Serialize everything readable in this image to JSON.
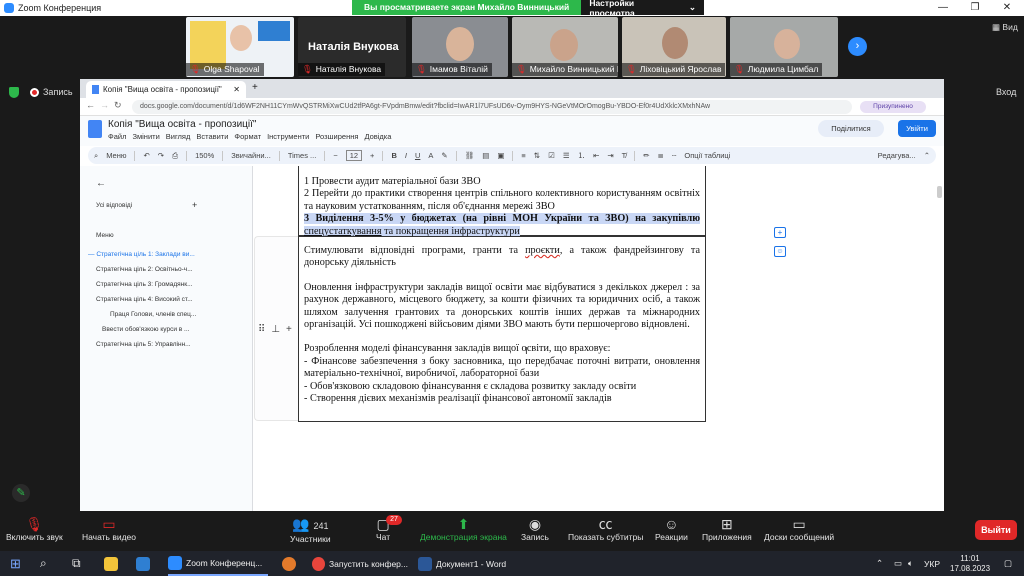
{
  "zoom": {
    "window_title": "Zoom Конференция",
    "share_message": "Вы просматриваете экран Михайло Винницький МОН",
    "view_options": "Настройки просмотра",
    "view_label": "Вид",
    "record_label": "Запись",
    "exit_label": "Вход",
    "participants": [
      {
        "name": "Olga Shapoval",
        "bg": "#dfe6ee"
      },
      {
        "name": "Наталія Внукова",
        "bg": "#2b2b2b"
      },
      {
        "name": "Імамов Віталій",
        "bg": "#8a8d92"
      },
      {
        "name": "Михайло Винницький М...",
        "bg": "#b9b9b5"
      },
      {
        "name": "Ліховіцький Ярослав",
        "bg": "#c9c3b8"
      },
      {
        "name": "Людмила Цимбал",
        "bg": "#a6a9a8"
      }
    ],
    "bottom": {
      "mic": "Включить звук",
      "video": "Начать видео",
      "participants": "Участники",
      "participants_count": "241",
      "chat": "Чат",
      "chat_badge": "27",
      "share": "Демонстрация экрана",
      "record": "Запись",
      "subtitles": "Показать субтитры",
      "reactions": "Реакции",
      "apps": "Приложения",
      "whiteboard": "Доски сообщений",
      "leave": "Выйти"
    }
  },
  "browser": {
    "tab_title": "Копія \"Вища освіта - пропозиції\"",
    "url": "docs.google.com/document/d/1d6WF2NH11CYmWvQSTRMiXwCUd2tfPA6gt-FVpdmBmw/edit?fbclid=IwAR1l7UFsUD6v-Oym9HYS-NGeVtMOrOmogBu-YBDO-Ef0r4UdXklcXMxhNAw",
    "profile_label": "Призупинено"
  },
  "docs": {
    "title": "Копія \"Вища освіта - пропозиції\"",
    "menu": [
      "Файл",
      "Змінити",
      "Вигляд",
      "Вставити",
      "Формат",
      "Інструменти",
      "Розширення",
      "Довідка"
    ],
    "share_button": "Поділитися",
    "login_button": "Увійти",
    "toolbar": {
      "menus": "Меню",
      "zoom": "150%",
      "style": "Звичайни...",
      "font": "Times ...",
      "size": "12",
      "table_options": "Опції таблиці",
      "edit_mode": "Редагува..."
    },
    "outline": {
      "hidden_label": "Усі відповіді",
      "menu_header": "Меню",
      "items": [
        "Стратегічна ціль 1: Заклади ви...",
        "Стратегічна ціль 2: Освітньо-ч...",
        "Стратегічна ціль 3: Громадянк...",
        "Стратегічна ціль 4: Високий ст...",
        "Праця Голови, членів спец...",
        "Ввести обов'язкою курси в ...",
        "Стратегічна ціль 5: Управлінн..."
      ]
    },
    "cell1": {
      "line1": "1 Провести аудит матеріальної бази ЗВО",
      "line2": "2 Перейти до практики створення центрів спільного колективного користуванням освітніх та науковим устаткованням, після об'єднання мережі ЗВО",
      "line3a": "3 ",
      "line3b": "Виділення 3-5% у бюджетах (на рівні МОН України та ЗВО) на закупівлю ",
      "line3c": "спецустаткування",
      "line3d": " та покращення інфраструктури"
    },
    "cell2": {
      "p1a": "Стимулювати відповідні програми, гранти та ",
      "p1b": "проєкти",
      "p1c": ", а також фандрейзингову та донорську діяльність",
      "p2": "Оновлення інфраструктури закладів вищої освіти має відбуватися з декількох джерел : за рахунок державного, місцевого бюджету, за кошти фізичних та юридичних осіб, а також шляхом залучення грантових та донорських коштів інших держав та міжнародних організацій. Усі пошкоджені війсьовим діями ЗВО мають бути першочергово відновлені.",
      "p3": "Розроблення моделі фінансування закладів вищої освіти, що враховує:",
      "b1": "-        Фінансове забезпечення з боку засновника, що передбачає поточні витрати, оновлення матеріально-технічної, виробничої, лабораторної бази",
      "b2": "-      Обов'язковою складовою фінансування є складова  розвитку закладу освіти",
      "b3": "-      Створення дієвих механізмів реалізації фінансової автономії закладів"
    }
  },
  "taskbar": {
    "items": [
      "Zoom Конференц...",
      "Запустить конфер...",
      "Документ1 - Word"
    ],
    "lang": "УКР",
    "time": "11:01",
    "date": "17.08.2023"
  },
  "colors": {
    "accent": "#1a73e8",
    "zoom_green": "#2db84b",
    "leave_red": "#e02828",
    "highlight": "#c9d7f5"
  }
}
